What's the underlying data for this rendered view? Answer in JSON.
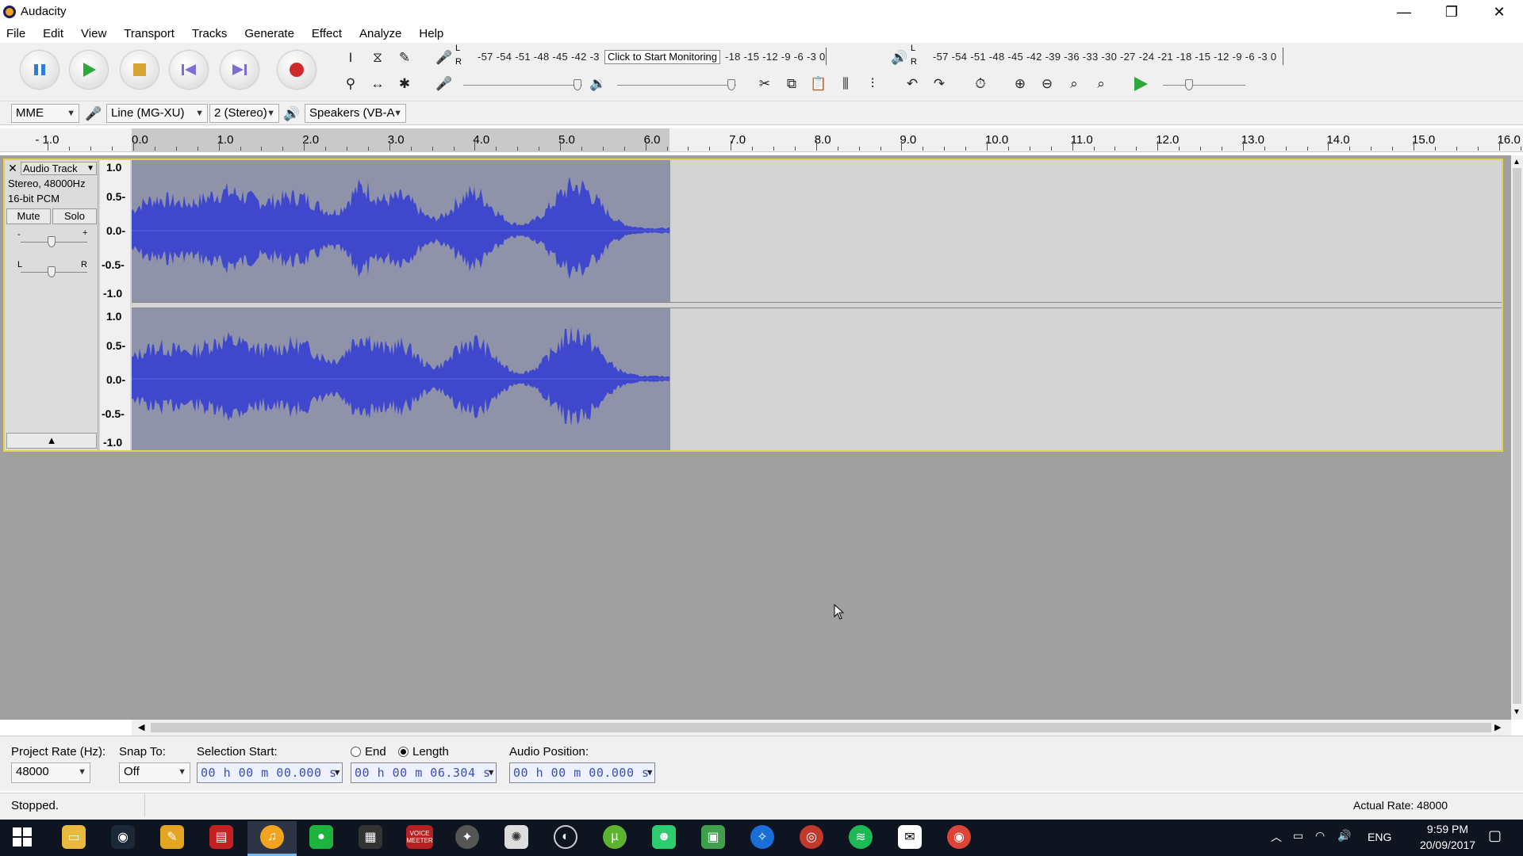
{
  "window": {
    "title": "Audacity",
    "minimize": "—",
    "restore": "❐",
    "close": "✕"
  },
  "menu": [
    "File",
    "Edit",
    "View",
    "Transport",
    "Tracks",
    "Generate",
    "Effect",
    "Analyze",
    "Help"
  ],
  "meters": {
    "record_scale": "-57 -54 -51 -48 -45 -42 -3",
    "record_scale_tail": "-18 -15 -12  -9  -6  -3  0",
    "record_L": "L",
    "record_R": "R",
    "monitor_tooltip": "Click to Start Monitoring",
    "playback_scale": "-57 -54 -51 -48 -45 -42 -39 -36 -33 -30 -27 -24 -21 -18 -15 -12  -9  -6  -3  0",
    "playback_L": "L",
    "playback_R": "R"
  },
  "device": {
    "host": "MME",
    "input": "Line (MG-XU)",
    "channels": "2 (Stereo)",
    "output": "Speakers (VB-A"
  },
  "ruler": [
    "- 1.0",
    "0.0",
    "1.0",
    "2.0",
    "3.0",
    "4.0",
    "5.0",
    "6.0",
    "7.0",
    "8.0",
    "9.0",
    "10.0",
    "11.0",
    "12.0",
    "13.0",
    "14.0",
    "15.0",
    "16.0"
  ],
  "track": {
    "name": "Audio Track",
    "info1": "Stereo, 48000Hz",
    "info2": "16-bit PCM",
    "mute": "Mute",
    "solo": "Solo",
    "gain_minus": "-",
    "gain_plus": "+",
    "pan_left": "L",
    "pan_right": "R",
    "collapse": "▲",
    "scale": [
      "1.0",
      "0.5-",
      "0.0-",
      "-0.5-",
      "-1.0"
    ]
  },
  "selection": {
    "project_rate_label": "Project Rate (Hz):",
    "project_rate": "48000",
    "snap_label": "Snap To:",
    "snap": "Off",
    "start_label": "Selection Start:",
    "start": "00 h 00 m 00.000 s",
    "end_label": "End",
    "length_label": "Length",
    "length": "00 h 00 m 06.304 s",
    "audio_pos_label": "Audio Position:",
    "audio_pos": "00 h 00 m 00.000 s"
  },
  "status": {
    "left": "Stopped.",
    "right": "Actual Rate: 48000"
  },
  "taskbar": {
    "lang": "ENG",
    "time": "9:59 PM",
    "date": "20/09/2017",
    "voice_meeter": "VOICE MEETER"
  },
  "colors": {
    "waveform": "#3f48cc",
    "selection_bg": "#8e93a9",
    "track_border": "#e1d255"
  }
}
